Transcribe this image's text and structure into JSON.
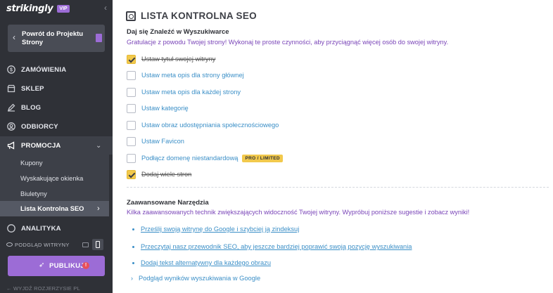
{
  "sidebar": {
    "brand": "strikingly",
    "vip_badge": "VIP",
    "back_button": "Powrót do Projektu Strony",
    "nav": [
      {
        "label": "ZAMÓWIENIA",
        "icon": "dollar-icon"
      },
      {
        "label": "SKLEP",
        "icon": "store-icon"
      },
      {
        "label": "BLOG",
        "icon": "pen-icon"
      },
      {
        "label": "ODBIORCY",
        "icon": "users-icon"
      },
      {
        "label": "PROMOCJA",
        "icon": "megaphone-icon"
      },
      {
        "label": "ANALITYKA",
        "icon": "chart-icon"
      }
    ],
    "promo_sub": [
      {
        "label": "Kupony"
      },
      {
        "label": "Wyskakujące okienka"
      },
      {
        "label": "Biuletyny"
      },
      {
        "label": "Lista Kontrolna SEO"
      }
    ],
    "preview_label": "PODGLĄD WITRYNY",
    "publish_label": "PUBLIKUJ",
    "publish_warning": "!",
    "footer": "← WYJDŹ   ROZJERZYSIE   PL"
  },
  "main": {
    "title": "LISTA KONTROLNA SEO",
    "section1": {
      "title": "Daj się Znaleźć w Wyszukiwarce",
      "desc": "Gratulacje z powodu Twojej strony! Wykonaj te proste czynności, aby przyciągnąć więcej osób do swojej witryny.",
      "items": [
        {
          "label": "Ustaw tytuł swojej witryny",
          "checked": true
        },
        {
          "label": "Ustaw meta opis dla strony głównej",
          "checked": false
        },
        {
          "label": "Ustaw meta opis dla każdej strony",
          "checked": false
        },
        {
          "label": "Ustaw kategorię",
          "checked": false
        },
        {
          "label": "Ustaw obraz udostępniania społecznościowego",
          "checked": false
        },
        {
          "label": "Ustaw Favicon",
          "checked": false
        },
        {
          "label": "Podłącz domenę niestandardową",
          "checked": false,
          "badge": "PRO / LIMITED"
        },
        {
          "label": "Dodaj wiele stron",
          "checked": true
        }
      ]
    },
    "section2": {
      "title": "Zaawansowane Narzędzia",
      "desc": "Kilka zaawansowanych technik zwiększających widoczność Twojej witryny. Wypróbuj poniższe sugestie i zobacz wyniki!",
      "links": [
        "Prześlij swoją witrynę do Google i szybciej ją zindeksuj",
        "Przeczytaj nasz przewodnik SEO, aby jeszcze bardziej poprawić swoją pozycję wyszukiwania",
        "Dodaj tekst alternatywny dla każdego obrazu"
      ],
      "expand": "Podgląd wyników wyszukiwania w Google"
    }
  },
  "colors": {
    "sidebar_bg": "#2f3137",
    "accent_purple": "#9c6cd6",
    "link_blue": "#3b8fc7",
    "check_yellow": "#f2c94c"
  }
}
